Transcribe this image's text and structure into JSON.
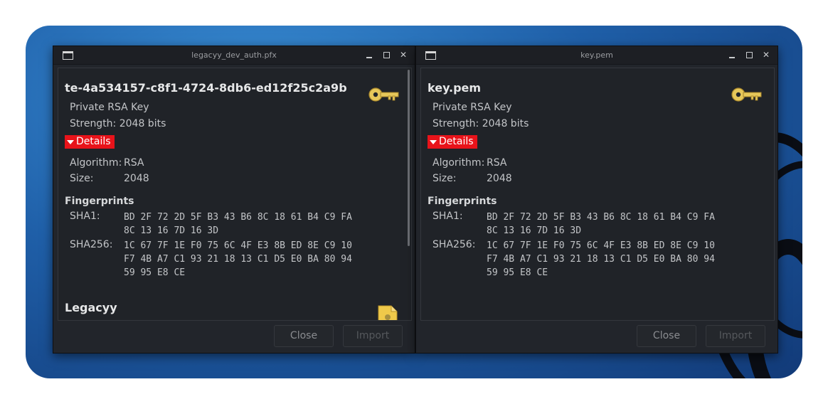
{
  "windows": [
    {
      "title": "legacyy_dev_auth.pfx",
      "heading": "te-4a534157-c8f1-4724-8db6-ed12f25c2a9b",
      "key_type": "Private RSA Key",
      "strength": "Strength: 2048 bits",
      "details_label": "Details",
      "algorithm_label": "Algorithm:",
      "algorithm_value": "RSA",
      "size_label": "Size:",
      "size_value": "2048",
      "fingerprints_label": "Fingerprints",
      "sha1_label": "SHA1:",
      "sha1_value": "BD 2F 72 2D 5F B3 43 B6 8C 18 61 B4 C9 FA\n8C 13 16 7D 16 3D",
      "sha256_label": "SHA256:",
      "sha256_value": "1C 67 7F 1E F0 75 6C 4F E3 8B ED 8E C9 10\nF7 4B A7 C1 93 21 18 13 C1 D5 E0 BA 80 94\n59 95 E8 CE",
      "second_heading": "Legacyy",
      "close_label": "Close",
      "import_label": "Import"
    },
    {
      "title": "key.pem",
      "heading": "key.pem",
      "key_type": "Private RSA Key",
      "strength": "Strength: 2048 bits",
      "details_label": "Details",
      "algorithm_label": "Algorithm:",
      "algorithm_value": "RSA",
      "size_label": "Size:",
      "size_value": "2048",
      "fingerprints_label": "Fingerprints",
      "sha1_label": "SHA1:",
      "sha1_value": "BD 2F 72 2D 5F B3 43 B6 8C 18 61 B4 C9 FA\n8C 13 16 7D 16 3D",
      "sha256_label": "SHA256:",
      "sha256_value": "1C 67 7F 1E F0 75 6C 4F E3 8B ED 8E C9 10\nF7 4B A7 C1 93 21 18 13 C1 D5 E0 BA 80 94\n59 95 E8 CE",
      "close_label": "Close",
      "import_label": "Import"
    }
  ],
  "icons": {
    "window_app": "window-icon",
    "minimize": "minimize-icon",
    "maximize": "maximize-icon",
    "close": "close-icon",
    "key": "key-icon",
    "certificate": "certificate-icon"
  },
  "colors": {
    "accent": "#e8131a",
    "key_gold": "#e6c75a",
    "window_bg": "#22252b"
  }
}
